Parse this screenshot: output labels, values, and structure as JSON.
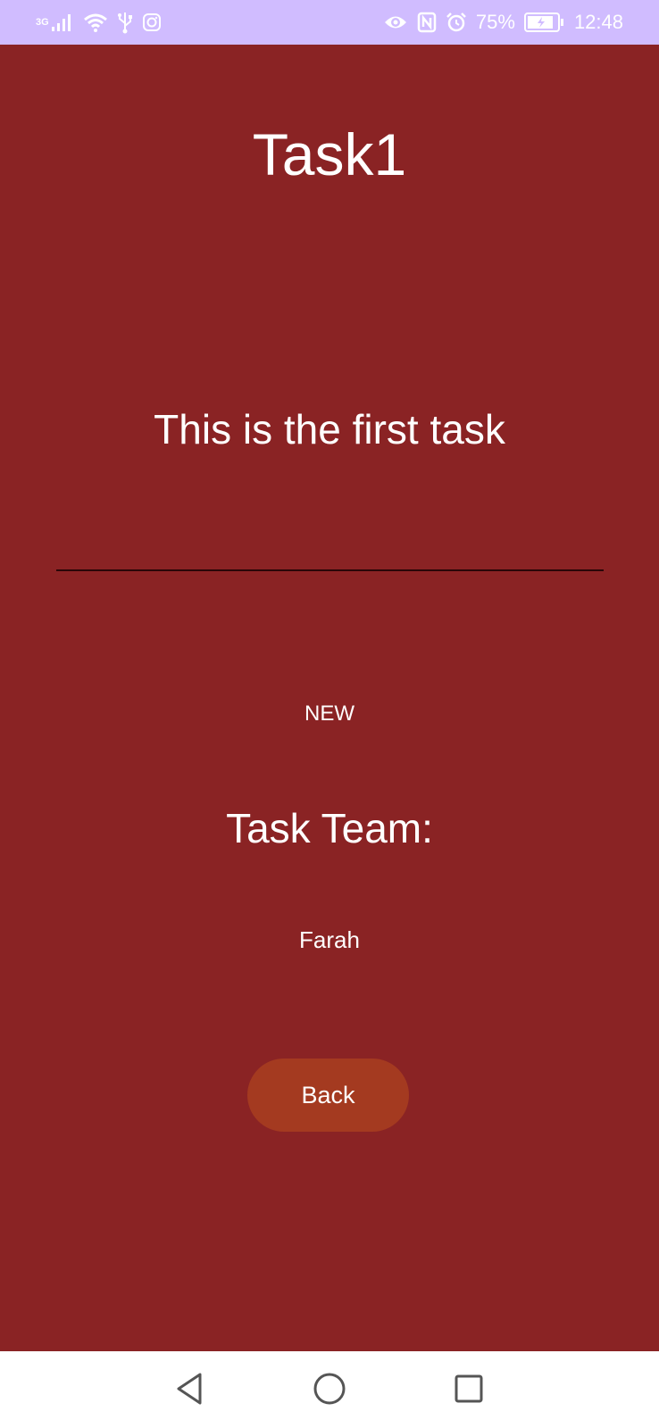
{
  "status_bar": {
    "network_type": "3G",
    "battery_percent": "75%",
    "time": "12:48",
    "background_color": "#d0bcff",
    "left_icons": [
      "signal-icon",
      "wifi-icon",
      "usb-icon",
      "instagram-icon"
    ],
    "right_icons": [
      "eye-icon",
      "nfc-icon",
      "alarm-icon",
      "battery-charging-icon"
    ]
  },
  "task": {
    "title": "Task1",
    "description": "This is the first task",
    "status": "NEW",
    "team_heading": "Task Team:",
    "team_members": [
      "Farah"
    ],
    "back_label": "Back"
  },
  "colors": {
    "background": "#8a2324",
    "button": "#a43a20",
    "nav_bar": "#ffffff"
  },
  "nav_bar": {
    "buttons": [
      "back-triangle-icon",
      "home-circle-icon",
      "recents-square-icon"
    ]
  }
}
